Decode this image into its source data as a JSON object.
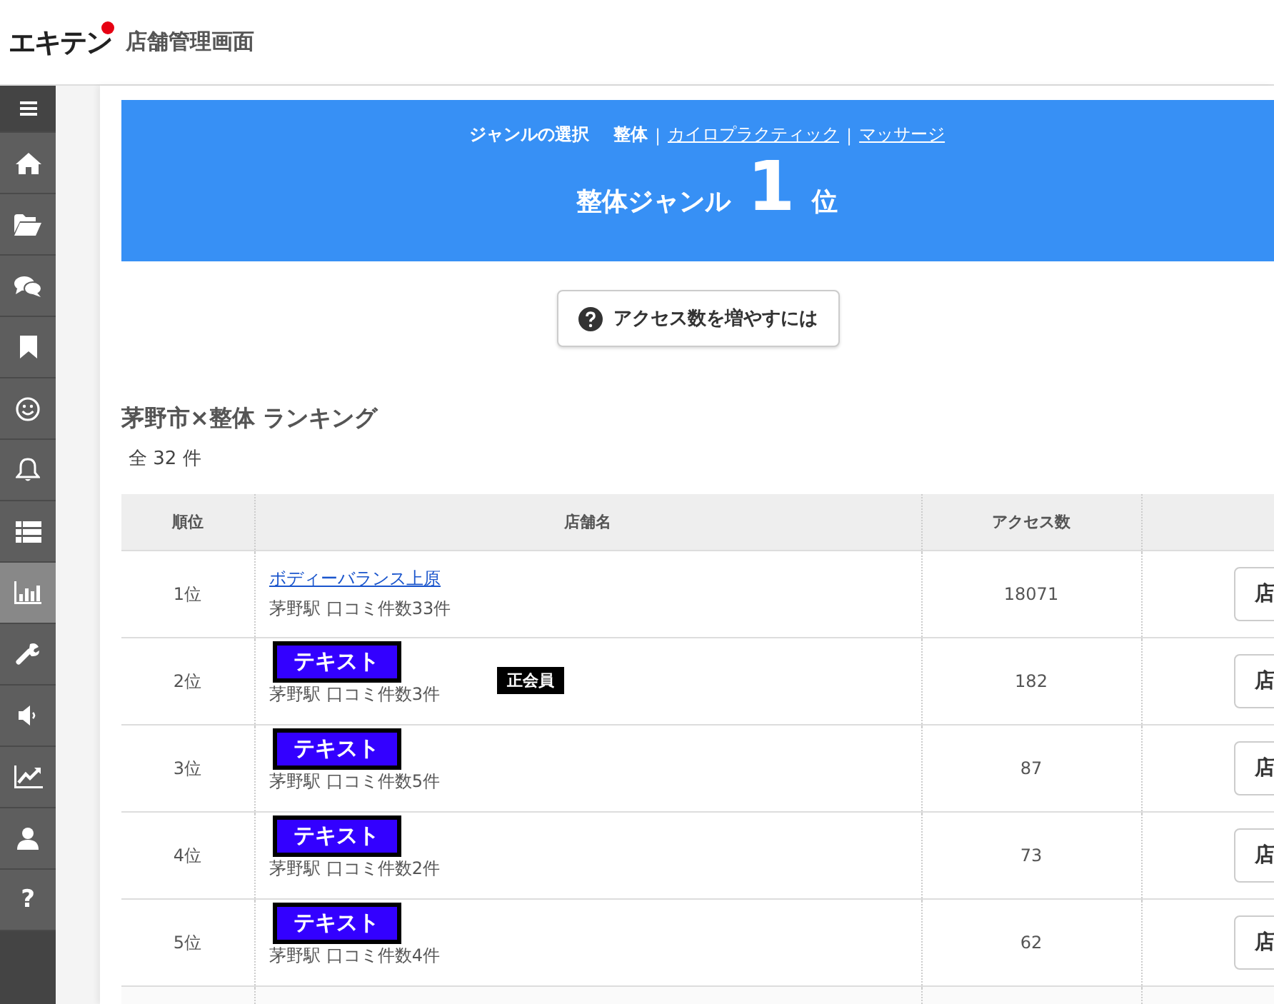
{
  "header": {
    "logo": "エキテン",
    "title": "店舗管理画面"
  },
  "sidebar": {
    "items": [
      {
        "kind": "menu",
        "selected": false
      },
      {
        "kind": "home",
        "selected": false
      },
      {
        "kind": "folder",
        "selected": false
      },
      {
        "kind": "chat",
        "selected": false
      },
      {
        "kind": "bookmark",
        "selected": false
      },
      {
        "kind": "smile",
        "selected": false
      },
      {
        "kind": "bell",
        "selected": false
      },
      {
        "kind": "list",
        "selected": false
      },
      {
        "kind": "barchart",
        "selected": true
      },
      {
        "kind": "wrench",
        "selected": false
      },
      {
        "kind": "speaker",
        "selected": false
      },
      {
        "kind": "linechart",
        "selected": false
      },
      {
        "kind": "user",
        "selected": false
      },
      {
        "kind": "help",
        "label": "?",
        "selected": false
      }
    ]
  },
  "banner": {
    "genre_label": "ジャンルの選択",
    "genres": [
      {
        "label": "整体",
        "selected": true
      },
      {
        "label": "カイロプラクティック",
        "selected": false
      },
      {
        "label": "マッサージ",
        "selected": false
      }
    ],
    "separator": "|",
    "rank_title": "整体ジャンル",
    "rank": "1",
    "rank_suffix": "位"
  },
  "help_button": "アクセス数を増やすには",
  "ranking": {
    "title": "茅野市×整体 ランキング",
    "total": "全 32 件",
    "columns": [
      "順位",
      "店舗名",
      "アクセス数"
    ],
    "rows": [
      {
        "rank": "1位",
        "name": "ボディーバランス上原",
        "redaction": null,
        "info": "茅野駅 口コミ件数33件",
        "badge": null,
        "access": "18071",
        "button": "店"
      },
      {
        "rank": "2位",
        "name": null,
        "redaction": "テキスト",
        "info": "茅野駅 口コミ件数3件",
        "badge": "正会員",
        "access": "182",
        "button": "店"
      },
      {
        "rank": "3位",
        "name": null,
        "redaction": "テキスト",
        "info": "茅野駅 口コミ件数5件",
        "badge": null,
        "access": "87",
        "button": "店"
      },
      {
        "rank": "4位",
        "name": null,
        "redaction": "テキスト",
        "info": "茅野駅 口コミ件数2件",
        "badge": null,
        "access": "73",
        "button": "店"
      },
      {
        "rank": "5位",
        "name": null,
        "redaction": "テキスト",
        "info": "茅野駅 口コミ件数4件",
        "badge": null,
        "access": "62",
        "button": "店"
      }
    ]
  }
}
